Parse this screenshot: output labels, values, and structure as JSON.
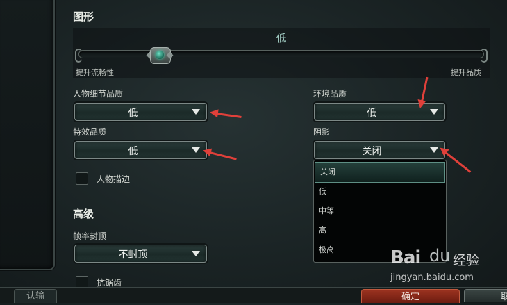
{
  "graphics": {
    "title": "图形",
    "quality_value": "低",
    "slider_min_label": "提升流畅性",
    "slider_max_label": "提升品质",
    "slider_level": 0.2
  },
  "character_detail": {
    "label": "人物细节品质",
    "value": "低"
  },
  "effects": {
    "label": "特效品质",
    "value": "低"
  },
  "environment": {
    "label": "环境品质",
    "value": "低"
  },
  "shadow": {
    "label": "阴影",
    "value": "关闭",
    "options": [
      "关闭",
      "低",
      "中等",
      "高",
      "极高"
    ],
    "selected_index": 0
  },
  "outline_checkbox": {
    "label": "人物描边",
    "checked": false
  },
  "advanced": {
    "title": "高级",
    "framerate_label": "帧率封顶",
    "framerate_value": "不封顶",
    "antialias_label": "抗锯齿",
    "antialias_checked": false
  },
  "bottom": {
    "auth_tab": "认输",
    "confirm_button": "确定",
    "more_button": "取"
  },
  "annotation": {
    "arrow_color": "#e0403a"
  },
  "watermark": {
    "logo": "Bai",
    "paw": "du",
    "site_cn": "经验",
    "url": "jingyan.baidu.com"
  }
}
